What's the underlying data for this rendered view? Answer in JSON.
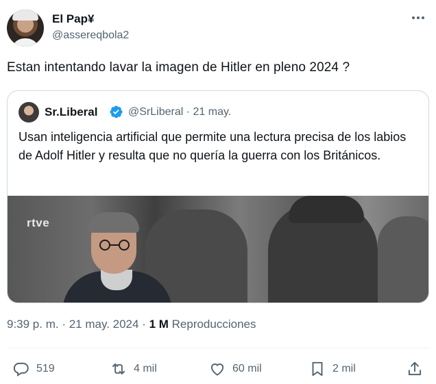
{
  "author": {
    "name": "El Pap¥",
    "handle": "@assereqbola2"
  },
  "tweet": {
    "text": "Estan intentando lavar la imagen de Hitler en pleno 2024 ?"
  },
  "quoted": {
    "name": "Sr.Liberal",
    "handle_time": "@SrLiberal · 21 may.",
    "text": "Usan inteligencia artificial que permite una lectura precisa de los labios de Adolf Hitler y resulta que no quería la guerra con los Británicos.",
    "media_logo": "rtve"
  },
  "meta": {
    "time_date": "9:39 p. m. · 21 may. 2024 · ",
    "views_count": "1 M",
    "views_label": " Reproducciones"
  },
  "actions": {
    "replies": "519",
    "reposts": "4 mil",
    "likes": "60 mil",
    "bookmarks": "2 mil"
  },
  "colors": {
    "verified": "#1d9bf0",
    "secondary_text": "#536471",
    "primary_text": "#0f1419",
    "border": "#cfd9de"
  },
  "icons": {
    "more": "more-icon",
    "verified": "verified-badge-icon",
    "reply": "reply-icon",
    "repost": "repost-icon",
    "like": "like-icon",
    "bookmark": "bookmark-icon",
    "share": "share-icon"
  }
}
